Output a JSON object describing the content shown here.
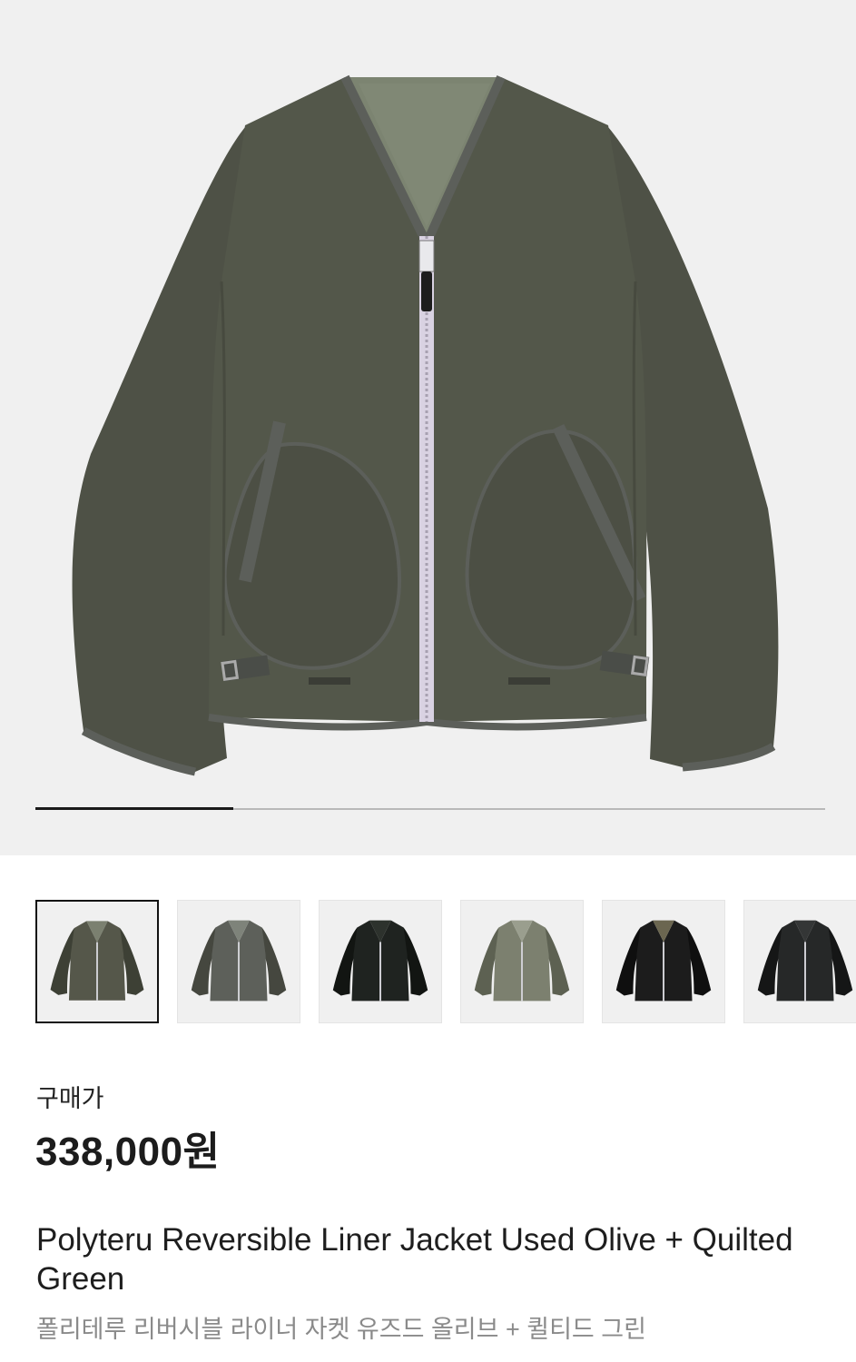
{
  "product": {
    "image_alt": "olive reversible liner jacket",
    "gallery_position": 1,
    "gallery_total": 4,
    "thumbnails": [
      {
        "name": "thumb-olive-front",
        "body": "#55574a",
        "collar": "#7b8070",
        "dark": "#3d4035"
      },
      {
        "name": "thumb-olive-faded",
        "body": "#5d605a",
        "collar": "#7e837a",
        "dark": "#45473f"
      },
      {
        "name": "thumb-black",
        "body": "#1f2320",
        "collar": "#2d322d",
        "dark": "#121512"
      },
      {
        "name": "thumb-quilted-green",
        "body": "#7c806f",
        "collar": "#9a9e8e",
        "dark": "#5d6152"
      },
      {
        "name": "thumb-black-quilted",
        "body": "#1c1c1c",
        "collar": "#6b6650",
        "dark": "#0f0f0f"
      },
      {
        "name": "thumb-black-2",
        "body": "#262828",
        "collar": "#343636",
        "dark": "#151616"
      }
    ],
    "price_label": "구매가",
    "price": "338,000원",
    "title_en": "Polyteru Reversible Liner Jacket Used Olive + Quilted Green",
    "title_ko": "폴리테루 리버시블 라이너 자켓 유즈드 올리브 + 퀼티드 그린"
  },
  "colors": {
    "hero_bg": "#f0f0f0",
    "jacket_body": "#53574a",
    "jacket_shadow": "#474a3f",
    "jacket_trim": "#5c5f5a",
    "lining": "#7c8471",
    "zipper": "#d9d2e2",
    "progress_fill": "#1a1a1a",
    "progress_track": "#b9b9b9"
  }
}
